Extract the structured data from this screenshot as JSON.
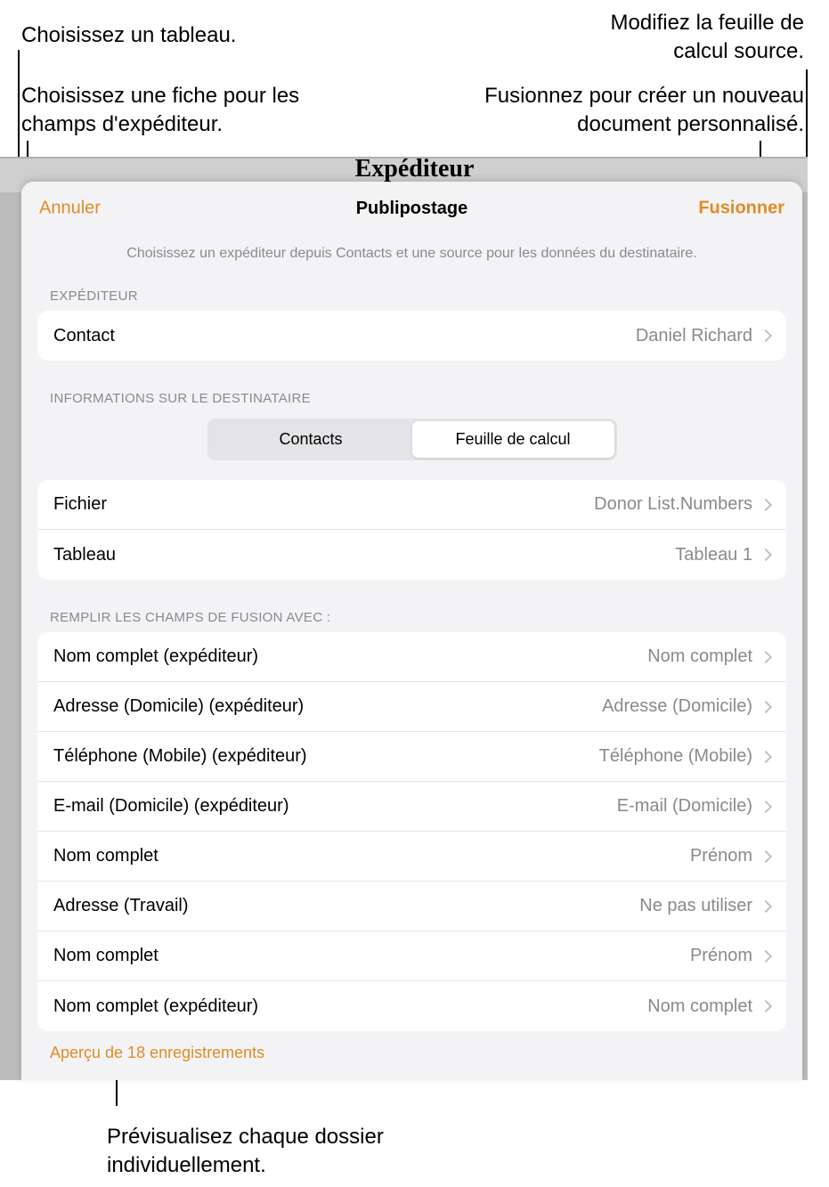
{
  "callouts": {
    "top_left": "Choisissez un tableau.",
    "mid_left": "Choisissez une fiche pour les champs d'expéditeur.",
    "top_right": "Modifiez la feuille de calcul source.",
    "mid_right": "Fusionnez pour créer un nouveau document personnalisé.",
    "bottom": "Prévisualisez chaque dossier individuellement."
  },
  "background_title": "Expéditeur",
  "sheet": {
    "cancel": "Annuler",
    "title": "Publipostage",
    "merge": "Fusionner",
    "subtitle": "Choisissez un expéditeur depuis Contacts et une source pour les données du destinataire."
  },
  "sender": {
    "section_label": "EXPÉDITEUR",
    "row_label": "Contact",
    "row_value": "Daniel Richard"
  },
  "recipient": {
    "section_label": "INFORMATIONS SUR LE DESTINATAIRE",
    "segment_contacts": "Contacts",
    "segment_spreadsheet": "Feuille de calcul",
    "file_label": "Fichier",
    "file_value": "Donor List.Numbers",
    "table_label": "Tableau",
    "table_value": "Tableau 1"
  },
  "fields": {
    "section_label": "REMPLIR LES CHAMPS DE FUSION AVEC :",
    "rows": [
      {
        "label": "Nom complet (expéditeur)",
        "value": "Nom complet"
      },
      {
        "label": "Adresse (Domicile) (expéditeur)",
        "value": "Adresse (Domicile)"
      },
      {
        "label": "Téléphone (Mobile) (expéditeur)",
        "value": "Téléphone (Mobile)"
      },
      {
        "label": "E-mail (Domicile) (expéditeur)",
        "value": "E-mail (Domicile)"
      },
      {
        "label": "Nom complet",
        "value": "Prénom"
      },
      {
        "label": "Adresse (Travail)",
        "value": "Ne pas utiliser"
      },
      {
        "label": "Nom complet",
        "value": "Prénom"
      },
      {
        "label": "Nom complet (expéditeur)",
        "value": "Nom complet"
      }
    ]
  },
  "preview_link": "Aperçu de 18 enregistrements"
}
